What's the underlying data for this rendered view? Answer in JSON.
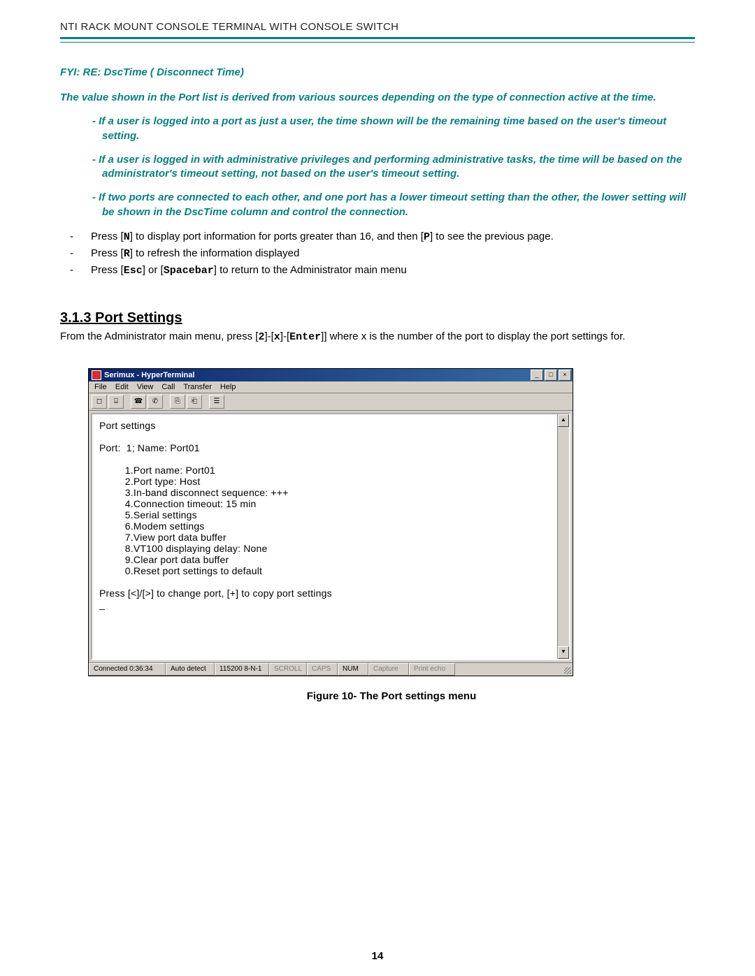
{
  "header_title": "NTI RACK MOUNT CONSOLE TERMINAL WITH CONSOLE SWITCH",
  "page_number": "14",
  "fyi": {
    "heading": "FYI: RE: DscTime ( Disconnect Time)",
    "body": "The value shown in the Port list is derived from various sources depending on the type of connection active at the time.",
    "bullets": [
      "If a user is logged into a port as just a user,  the time shown will be the remaining time based on the user's timeout setting.",
      "If a user is logged in with administrative privileges and performing administrative tasks,  the time will be based on the  administrator's timeout setting,  not based on the user's timeout setting.",
      "If two ports are connected to each other,  and one port has a lower timeout setting than the other,   the lower setting will be shown in the DscTime column and control the connection."
    ]
  },
  "press": {
    "n": {
      "pre": "Press [",
      "k": "N",
      "post": "] to display port information for ports greater than 16, and then [",
      "k2": "P",
      "post2": "] to see the previous page."
    },
    "r": {
      "pre": "Press [",
      "k": "R",
      "post": "] to refresh the information displayed"
    },
    "esc": {
      "pre": "Press [",
      "k": "Esc",
      "mid": "] or [",
      "k2": "Spacebar",
      "post": "] to return to the Administrator main menu"
    }
  },
  "section": {
    "title": "3.1.3 Port Settings",
    "body_pre": "From the Administrator main menu, press [",
    "k1": "2",
    "s1": "]-[",
    "k2": "x",
    "s2": "]-[",
    "k3": "Enter",
    "body_post": "]] where x is the number of the port to display the port settings for."
  },
  "figure_caption": "Figure 10- The Port settings menu",
  "window": {
    "title": "Serimux - HyperTerminal",
    "menus": [
      "File",
      "Edit",
      "View",
      "Call",
      "Transfer",
      "Help"
    ],
    "btn_min": "_",
    "btn_max": "□",
    "btn_close": "×",
    "scroll_up": "▲",
    "scroll_down": "▼",
    "status": {
      "conn": "Connected 0:36:34",
      "detect": "Auto detect",
      "line": "115200 8-N-1",
      "scroll": "SCROLL",
      "caps": "CAPS",
      "num": "NUM",
      "capture": "Capture",
      "echo": "Print echo"
    },
    "terminal": "Port settings\n\nPort:  1; Name: Port01\n\n         1.Port name: Port01\n         2.Port type: Host\n         3.In-band disconnect sequence: +++\n         4.Connection timeout: 15 min\n         5.Serial settings\n         6.Modem settings\n         7.View port data buffer\n         8.VT100 displaying delay: None\n         9.Clear port data buffer\n         0.Reset port settings to default\n\nPress [<]/[>] to change port, [+] to copy port settings\n_"
  }
}
